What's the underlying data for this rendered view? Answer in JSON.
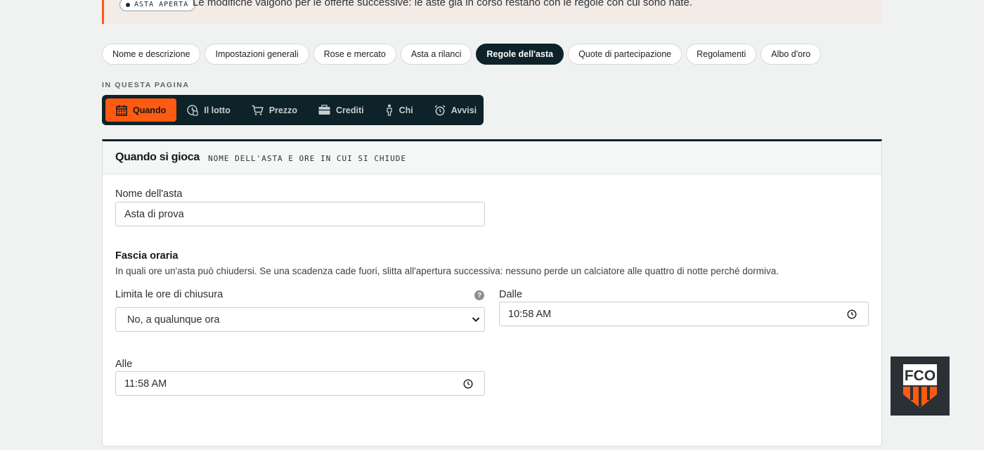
{
  "banner": {
    "badge": "ASTA APERTA",
    "text": "Le modifiche valgono per le offerte successive: le aste già in corso restano con le regole con cui sono nate."
  },
  "tabs": [
    {
      "label": "Nome e descrizione",
      "active": false
    },
    {
      "label": "Impostazioni generali",
      "active": false
    },
    {
      "label": "Rose e mercato",
      "active": false
    },
    {
      "label": "Asta a rilanci",
      "active": false
    },
    {
      "label": "Regole dell'asta",
      "active": true
    },
    {
      "label": "Quote di partecipazione",
      "active": false
    },
    {
      "label": "Regolamenti",
      "active": false
    },
    {
      "label": "Albo d'oro",
      "active": false
    }
  ],
  "page_nav": {
    "label": "IN QUESTA PAGINA",
    "items": [
      {
        "label": "Quando",
        "icon": "calendar-icon",
        "active": true
      },
      {
        "label": "Il lotto",
        "icon": "lot-icon",
        "active": false
      },
      {
        "label": "Prezzo",
        "icon": "cart-icon",
        "active": false
      },
      {
        "label": "Crediti",
        "icon": "wallet-icon",
        "active": false
      },
      {
        "label": "Chi",
        "icon": "person-icon",
        "active": false
      },
      {
        "label": "Avvisi",
        "icon": "alarm-icon",
        "active": false
      }
    ]
  },
  "card": {
    "title": "Quando si gioca",
    "subtitle": "NOME DELL'ASTA E ORE IN CUI SI CHIUDE",
    "name_label": "Nome dell'asta",
    "name_value": "Asta di prova",
    "group_title": "Fascia oraria",
    "group_desc": "In quali ore un'asta può chiudersi. Se una scadenza cade fuori, slitta all'apertura successiva: nessuno perde un calciatore alle quattro di notte perché dormiva.",
    "limit_label": "Limita le ore di chiusura",
    "limit_value": "No, a qualunque ora",
    "help_glyph": "?",
    "from_label": "Dalle",
    "from_value": "10:58 AM",
    "to_label": "Alle",
    "to_value": "11:58 AM"
  },
  "fab": {
    "logo_text": "FCO"
  },
  "colors": {
    "accent": "#ff5a12",
    "dark": "#0d2229"
  }
}
